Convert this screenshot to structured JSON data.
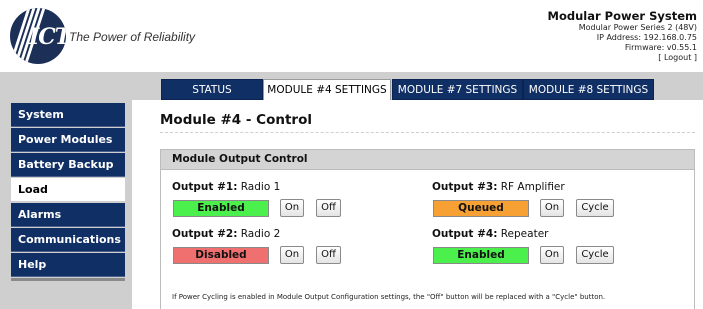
{
  "header": {
    "logo_text": "ICT",
    "tagline": "The Power of Reliability",
    "system_title": "Modular Power System",
    "system_model": "Modular Power Series 2 (48V)",
    "ip_address": "IP Address: 192.168.0.75",
    "firmware": "Firmware: v0.55.1",
    "logout": "[ Logout ]"
  },
  "tabs": [
    {
      "label": "STATUS",
      "active": false
    },
    {
      "label": "MODULE #4 SETTINGS",
      "active": true
    },
    {
      "label": "MODULE #7 SETTINGS",
      "active": false
    },
    {
      "label": "MODULE #8 SETTINGS",
      "active": false
    }
  ],
  "sidebar": {
    "items": [
      {
        "label": "System",
        "active": false
      },
      {
        "label": "Power Modules",
        "active": false
      },
      {
        "label": "Battery Backup",
        "active": false
      },
      {
        "label": "Load Distribution",
        "active": true
      },
      {
        "label": "Alarms",
        "active": false
      },
      {
        "label": "Communications",
        "active": false
      },
      {
        "label": "Help",
        "active": false
      }
    ]
  },
  "page": {
    "title": "Module #4 - Control",
    "section_title": "Module Output Control",
    "note": "If Power Cycling is enabled in Module Output Configuration settings, the \"Off\" button will be replaced with a \"Cycle\" button."
  },
  "outputs": [
    {
      "label": "Output #1:",
      "name": "Radio 1",
      "status": "Enabled",
      "status_color": "#4cf04c",
      "btn1": "On",
      "btn2": "Off"
    },
    {
      "label": "Output #2:",
      "name": "Radio 2",
      "status": "Disabled",
      "status_color": "#f07070",
      "btn1": "On",
      "btn2": "Off"
    },
    {
      "label": "Output #3:",
      "name": "RF Amplifier",
      "status": "Queued",
      "status_color": "#f7a033",
      "btn1": "On",
      "btn2": "Cycle"
    },
    {
      "label": "Output #4:",
      "name": "Repeater",
      "status": "Enabled",
      "status_color": "#4cf04c",
      "btn1": "On",
      "btn2": "Cycle"
    }
  ]
}
